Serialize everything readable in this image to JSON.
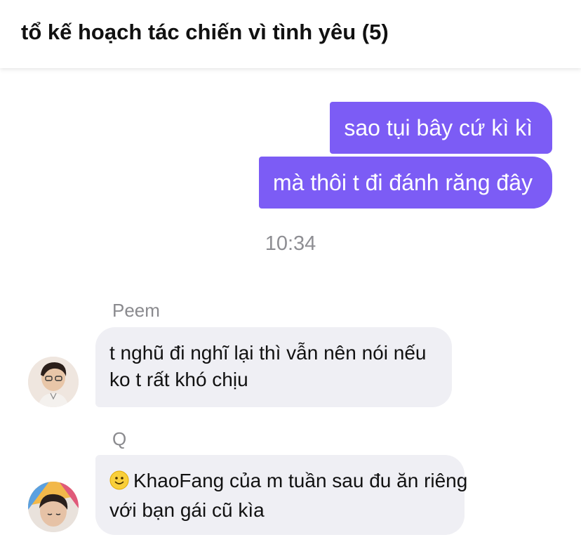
{
  "header": {
    "title": "tổ kế hoạch tác chiến vì tình yêu (5)"
  },
  "messages": {
    "outgoing": [
      {
        "text": "sao tụi bây cứ kì kì"
      },
      {
        "text": "mà thôi t đi đánh răng đây"
      }
    ],
    "timestamp": "10:34",
    "incoming": [
      {
        "sender": "Peem",
        "lines": [
          "t nghũ đi nghĩ lại thì vẫn nên nói nếu",
          "ko t rất khó chịu"
        ]
      },
      {
        "sender": "Q",
        "emoji": "slightly-smiling-face-icon",
        "lines": [
          "KhaoFang của m tuần sau đu ăn riêng",
          "với bạn gái cũ kìa"
        ]
      }
    ]
  },
  "colors": {
    "outgoing_bubble": "#7c5cf5",
    "incoming_bubble": "#efeff4",
    "timestamp": "#8e8e93"
  }
}
